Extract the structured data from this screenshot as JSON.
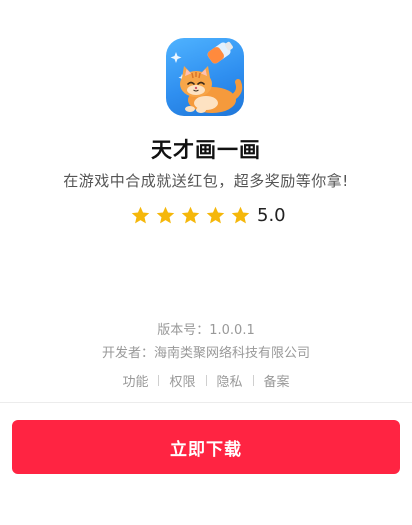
{
  "app": {
    "icon": "cat-bottle-app-icon",
    "name": "天才画一画",
    "tagline": "在游戏中合成就送红包，超多奖励等你拿!",
    "rating": {
      "stars": 5,
      "max_stars": 5,
      "value": "5.0",
      "star_color": "#f5b70a"
    }
  },
  "meta": {
    "version": "版本号：1.0.0.1",
    "developer": "开发者：海南类聚网络科技有限公司"
  },
  "links": [
    {
      "label": "功能"
    },
    {
      "label": "权限"
    },
    {
      "label": "隐私"
    },
    {
      "label": "备案"
    }
  ],
  "download_button": {
    "label": "立即下载",
    "color": "#ff2442"
  }
}
